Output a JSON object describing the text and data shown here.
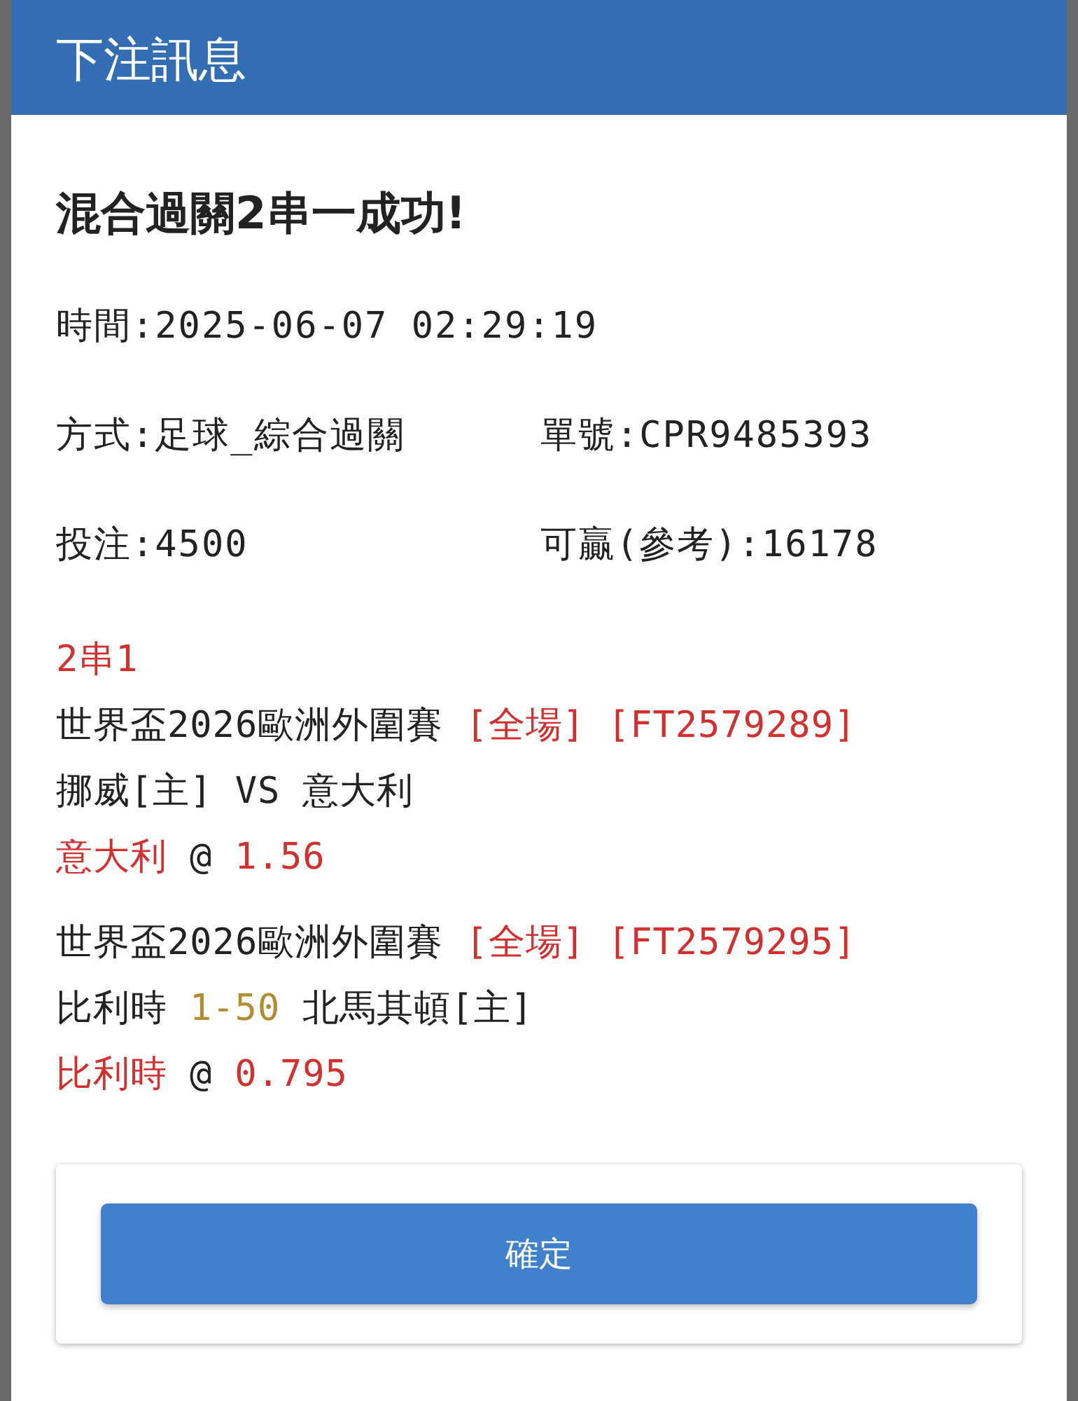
{
  "window": {
    "title": "下注訊息"
  },
  "heading": "混合過關2串一成功!",
  "info_rows": [
    [
      "時間:2025-06-07 02:29:19"
    ],
    [
      "方式:足球_綜合過關",
      "單號:CPR9485393"
    ],
    [
      "投注:4500",
      "可贏(參考):16178"
    ]
  ],
  "parlay_label": "2串1",
  "legs": [
    {
      "league": "世界盃2026歐洲外圍賽",
      "bet_type": "[全場]",
      "match_id": "[FT2579289]",
      "matchup": [
        {
          "kind": "team",
          "text": "挪威[主]"
        },
        {
          "kind": "versus",
          "text": "VS"
        },
        {
          "kind": "team",
          "text": "意大利"
        }
      ],
      "pick": "意大利",
      "at": "@",
      "odds": "1.56"
    },
    {
      "league": "世界盃2026歐洲外圍賽",
      "bet_type": "[全場]",
      "match_id": "[FT2579295]",
      "matchup": [
        {
          "kind": "team",
          "text": "比利時"
        },
        {
          "kind": "handicap",
          "text": "1-50"
        },
        {
          "kind": "team",
          "text": "北馬其頓[主]"
        }
      ],
      "pick": "比利時",
      "at": "@",
      "odds": "0.795"
    }
  ],
  "confirm_button": "確定"
}
